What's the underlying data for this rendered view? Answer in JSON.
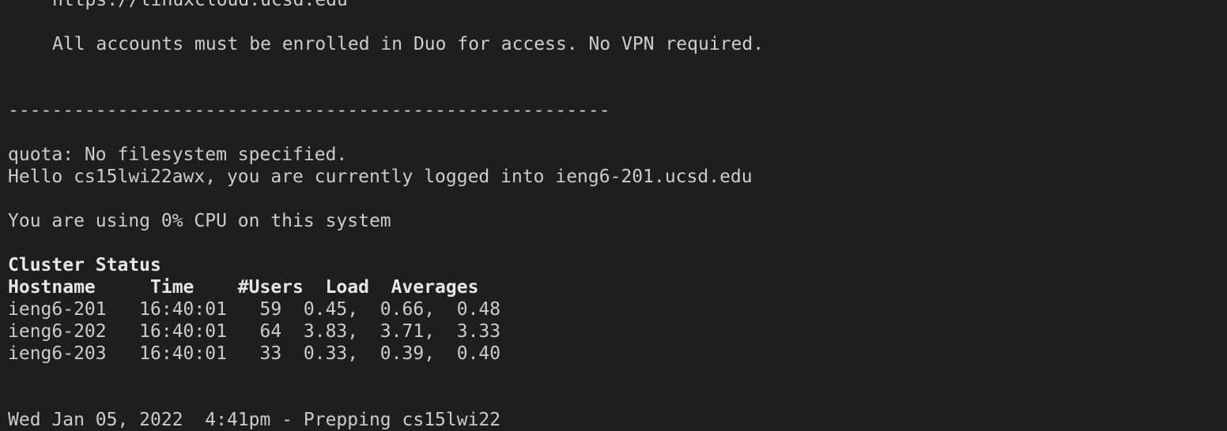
{
  "terminal": {
    "lines": {
      "url": "https://linuxcloud.ucsd.edu",
      "duo": "All accounts must be enrolled in Duo for access. No VPN required.",
      "divider": "-------------------------------------------------------",
      "quota": "quota: No filesystem specified.",
      "hello": "Hello cs15lwi22awx, you are currently logged into ieng6-201.ucsd.edu",
      "cpu": "You are using 0% CPU on this system",
      "cluster_title": "Cluster Status",
      "header": "Hostname     Time    #Users  Load  Averages",
      "row1": "ieng6-201   16:40:01   59  0.45,  0.66,  0.48",
      "row2": "ieng6-202   16:40:01   64  3.83,  3.71,  3.33",
      "row3": "ieng6-203   16:40:01   33  0.33,  0.39,  0.40",
      "prep": "Wed Jan 05, 2022  4:41pm - Prepping cs15lwi22"
    }
  }
}
